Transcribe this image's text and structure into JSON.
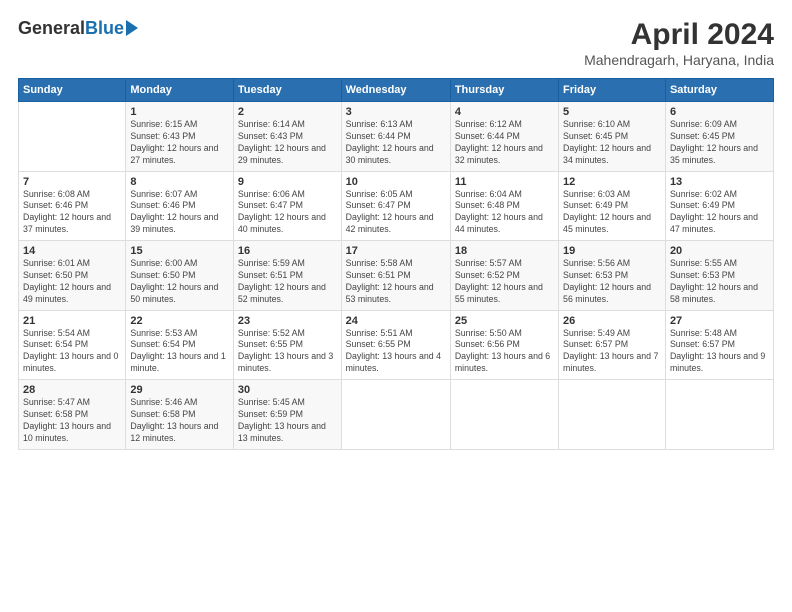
{
  "logo": {
    "general": "General",
    "blue": "Blue"
  },
  "title": "April 2024",
  "subtitle": "Mahendragarh, Haryana, India",
  "days_header": [
    "Sunday",
    "Monday",
    "Tuesday",
    "Wednesday",
    "Thursday",
    "Friday",
    "Saturday"
  ],
  "weeks": [
    [
      {
        "num": "",
        "sunrise": "",
        "sunset": "",
        "daylight": ""
      },
      {
        "num": "1",
        "sunrise": "Sunrise: 6:15 AM",
        "sunset": "Sunset: 6:43 PM",
        "daylight": "Daylight: 12 hours and 27 minutes."
      },
      {
        "num": "2",
        "sunrise": "Sunrise: 6:14 AM",
        "sunset": "Sunset: 6:43 PM",
        "daylight": "Daylight: 12 hours and 29 minutes."
      },
      {
        "num": "3",
        "sunrise": "Sunrise: 6:13 AM",
        "sunset": "Sunset: 6:44 PM",
        "daylight": "Daylight: 12 hours and 30 minutes."
      },
      {
        "num": "4",
        "sunrise": "Sunrise: 6:12 AM",
        "sunset": "Sunset: 6:44 PM",
        "daylight": "Daylight: 12 hours and 32 minutes."
      },
      {
        "num": "5",
        "sunrise": "Sunrise: 6:10 AM",
        "sunset": "Sunset: 6:45 PM",
        "daylight": "Daylight: 12 hours and 34 minutes."
      },
      {
        "num": "6",
        "sunrise": "Sunrise: 6:09 AM",
        "sunset": "Sunset: 6:45 PM",
        "daylight": "Daylight: 12 hours and 35 minutes."
      }
    ],
    [
      {
        "num": "7",
        "sunrise": "Sunrise: 6:08 AM",
        "sunset": "Sunset: 6:46 PM",
        "daylight": "Daylight: 12 hours and 37 minutes."
      },
      {
        "num": "8",
        "sunrise": "Sunrise: 6:07 AM",
        "sunset": "Sunset: 6:46 PM",
        "daylight": "Daylight: 12 hours and 39 minutes."
      },
      {
        "num": "9",
        "sunrise": "Sunrise: 6:06 AM",
        "sunset": "Sunset: 6:47 PM",
        "daylight": "Daylight: 12 hours and 40 minutes."
      },
      {
        "num": "10",
        "sunrise": "Sunrise: 6:05 AM",
        "sunset": "Sunset: 6:47 PM",
        "daylight": "Daylight: 12 hours and 42 minutes."
      },
      {
        "num": "11",
        "sunrise": "Sunrise: 6:04 AM",
        "sunset": "Sunset: 6:48 PM",
        "daylight": "Daylight: 12 hours and 44 minutes."
      },
      {
        "num": "12",
        "sunrise": "Sunrise: 6:03 AM",
        "sunset": "Sunset: 6:49 PM",
        "daylight": "Daylight: 12 hours and 45 minutes."
      },
      {
        "num": "13",
        "sunrise": "Sunrise: 6:02 AM",
        "sunset": "Sunset: 6:49 PM",
        "daylight": "Daylight: 12 hours and 47 minutes."
      }
    ],
    [
      {
        "num": "14",
        "sunrise": "Sunrise: 6:01 AM",
        "sunset": "Sunset: 6:50 PM",
        "daylight": "Daylight: 12 hours and 49 minutes."
      },
      {
        "num": "15",
        "sunrise": "Sunrise: 6:00 AM",
        "sunset": "Sunset: 6:50 PM",
        "daylight": "Daylight: 12 hours and 50 minutes."
      },
      {
        "num": "16",
        "sunrise": "Sunrise: 5:59 AM",
        "sunset": "Sunset: 6:51 PM",
        "daylight": "Daylight: 12 hours and 52 minutes."
      },
      {
        "num": "17",
        "sunrise": "Sunrise: 5:58 AM",
        "sunset": "Sunset: 6:51 PM",
        "daylight": "Daylight: 12 hours and 53 minutes."
      },
      {
        "num": "18",
        "sunrise": "Sunrise: 5:57 AM",
        "sunset": "Sunset: 6:52 PM",
        "daylight": "Daylight: 12 hours and 55 minutes."
      },
      {
        "num": "19",
        "sunrise": "Sunrise: 5:56 AM",
        "sunset": "Sunset: 6:53 PM",
        "daylight": "Daylight: 12 hours and 56 minutes."
      },
      {
        "num": "20",
        "sunrise": "Sunrise: 5:55 AM",
        "sunset": "Sunset: 6:53 PM",
        "daylight": "Daylight: 12 hours and 58 minutes."
      }
    ],
    [
      {
        "num": "21",
        "sunrise": "Sunrise: 5:54 AM",
        "sunset": "Sunset: 6:54 PM",
        "daylight": "Daylight: 13 hours and 0 minutes."
      },
      {
        "num": "22",
        "sunrise": "Sunrise: 5:53 AM",
        "sunset": "Sunset: 6:54 PM",
        "daylight": "Daylight: 13 hours and 1 minute."
      },
      {
        "num": "23",
        "sunrise": "Sunrise: 5:52 AM",
        "sunset": "Sunset: 6:55 PM",
        "daylight": "Daylight: 13 hours and 3 minutes."
      },
      {
        "num": "24",
        "sunrise": "Sunrise: 5:51 AM",
        "sunset": "Sunset: 6:55 PM",
        "daylight": "Daylight: 13 hours and 4 minutes."
      },
      {
        "num": "25",
        "sunrise": "Sunrise: 5:50 AM",
        "sunset": "Sunset: 6:56 PM",
        "daylight": "Daylight: 13 hours and 6 minutes."
      },
      {
        "num": "26",
        "sunrise": "Sunrise: 5:49 AM",
        "sunset": "Sunset: 6:57 PM",
        "daylight": "Daylight: 13 hours and 7 minutes."
      },
      {
        "num": "27",
        "sunrise": "Sunrise: 5:48 AM",
        "sunset": "Sunset: 6:57 PM",
        "daylight": "Daylight: 13 hours and 9 minutes."
      }
    ],
    [
      {
        "num": "28",
        "sunrise": "Sunrise: 5:47 AM",
        "sunset": "Sunset: 6:58 PM",
        "daylight": "Daylight: 13 hours and 10 minutes."
      },
      {
        "num": "29",
        "sunrise": "Sunrise: 5:46 AM",
        "sunset": "Sunset: 6:58 PM",
        "daylight": "Daylight: 13 hours and 12 minutes."
      },
      {
        "num": "30",
        "sunrise": "Sunrise: 5:45 AM",
        "sunset": "Sunset: 6:59 PM",
        "daylight": "Daylight: 13 hours and 13 minutes."
      },
      {
        "num": "",
        "sunrise": "",
        "sunset": "",
        "daylight": ""
      },
      {
        "num": "",
        "sunrise": "",
        "sunset": "",
        "daylight": ""
      },
      {
        "num": "",
        "sunrise": "",
        "sunset": "",
        "daylight": ""
      },
      {
        "num": "",
        "sunrise": "",
        "sunset": "",
        "daylight": ""
      }
    ]
  ]
}
